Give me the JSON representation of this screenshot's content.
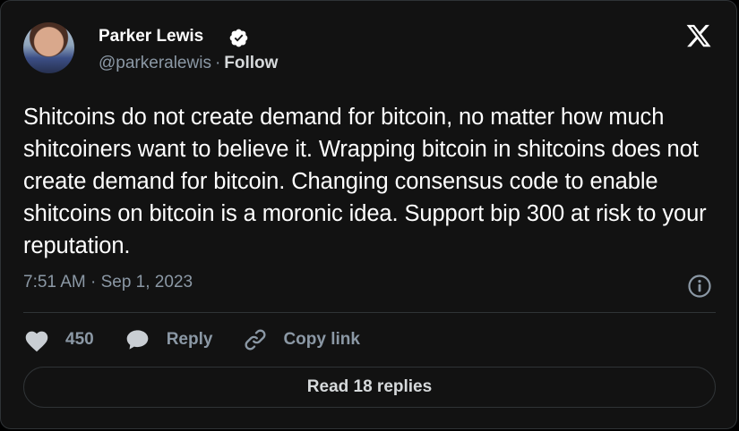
{
  "author": {
    "name": "Parker Lewis",
    "handle": "@parkeralewis",
    "separator": "·",
    "follow_label": "Follow"
  },
  "icons": {
    "verified": "verified-badge-icon",
    "logo": "x-logo-icon",
    "info": "info-icon",
    "like": "heart-icon",
    "reply": "speech-bubble-icon",
    "copy": "link-icon"
  },
  "tweet": {
    "text": "Shitcoins do not create demand for bitcoin, no matter how much shitcoiners want to believe it. Wrapping bitcoin in shitcoins does not create demand for bitcoin. Changing consensus code to enable shitcoins on bitcoin is a moronic idea. Support bip 300 at risk to your reputation.",
    "timestamp": "7:51 AM · Sep 1, 2023"
  },
  "actions": {
    "like_count": "450",
    "reply_label": "Reply",
    "copy_label": "Copy link"
  },
  "footer": {
    "read_replies_label": "Read 18 replies"
  },
  "colors": {
    "background": "#121212",
    "text_primary": "#ffffff",
    "text_secondary": "#8b98a5",
    "border": "#2f3336"
  }
}
